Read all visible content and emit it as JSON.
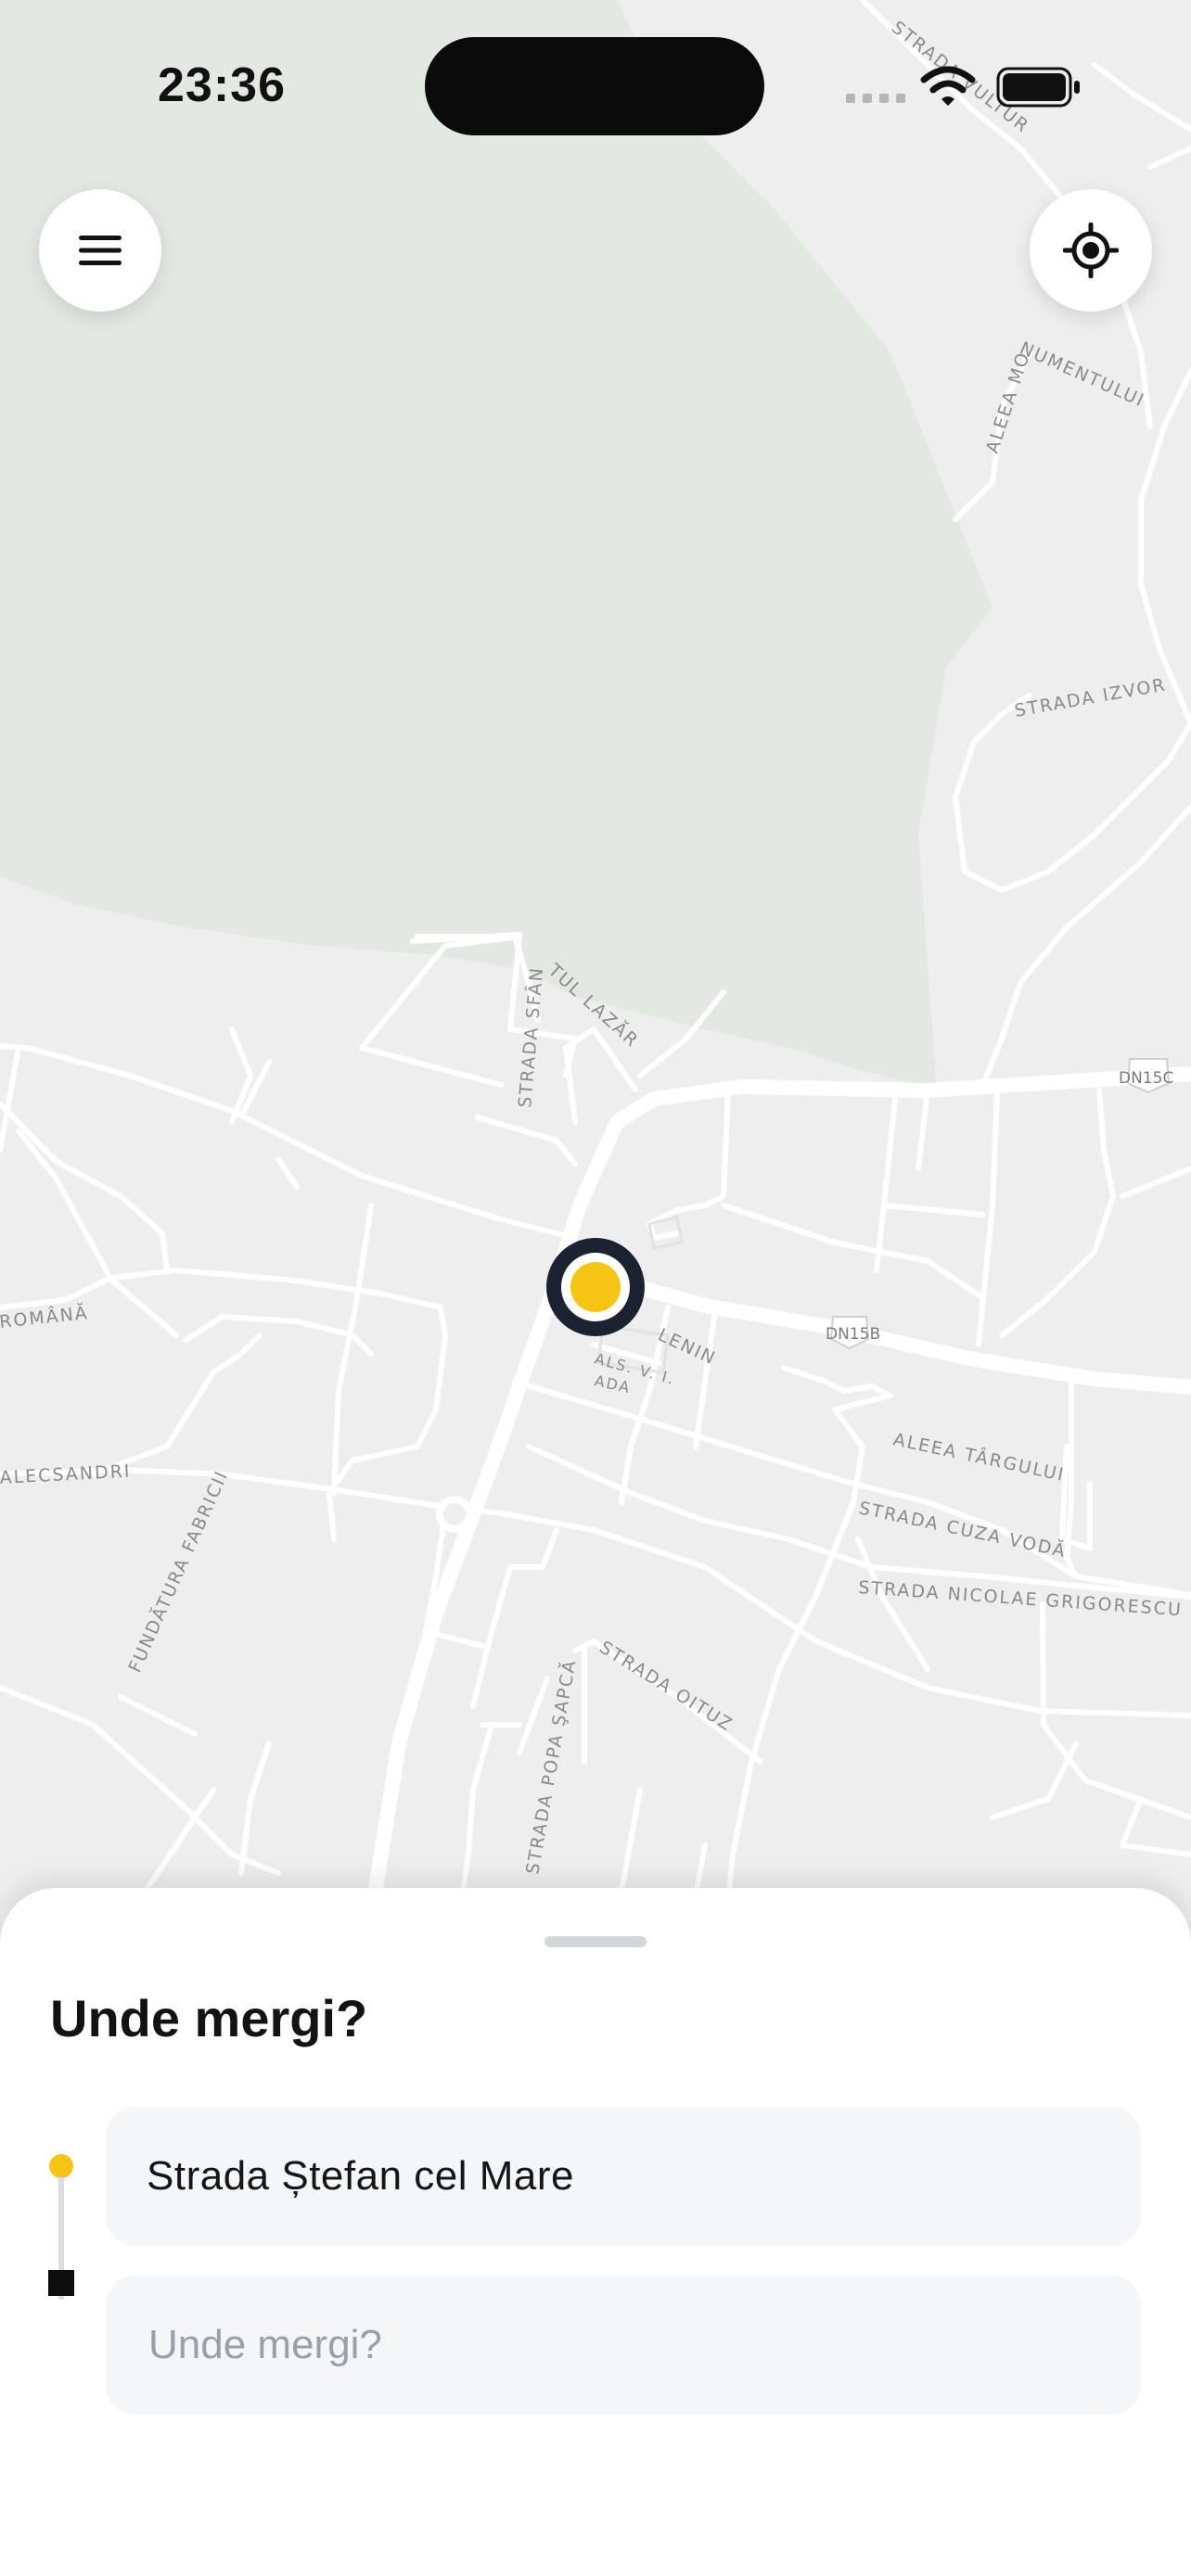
{
  "status_bar": {
    "time": "23:36"
  },
  "map": {
    "street_labels": [
      "STRADA VULTUR",
      "ALEEA MONUMENTULUI",
      "STRADA IZVOR",
      "STRADA SFÂNTUL LAZĂR",
      "LENIN",
      "ALEEA TÂRGULUI",
      "STRADA CUZA VODĂ",
      "STRADA NICOLAE GRIGORESCU",
      "STRADA OITUZ",
      "STRADA POPA ŞAPCĂ",
      "FUNDĂTURA FABRICII",
      "ALECSANDRI",
      "ROMÂNĂ"
    ],
    "road_shields": [
      "DN15C",
      "DN15B"
    ],
    "colors": {
      "background": "#eeeeee",
      "park": "#e3e8e3",
      "road": "#ffffff",
      "pin_ring": "#1c2230",
      "pin_center": "#f6c414"
    }
  },
  "controls": {
    "menu_icon": "hamburger-menu-icon",
    "locate_icon": "crosshair-locate-icon"
  },
  "sheet": {
    "title": "Unde mergi?",
    "origin_value": "Strada Ștefan cel Mare",
    "destination_placeholder": "Unde mergi?",
    "accent_color": "#f6c414"
  }
}
